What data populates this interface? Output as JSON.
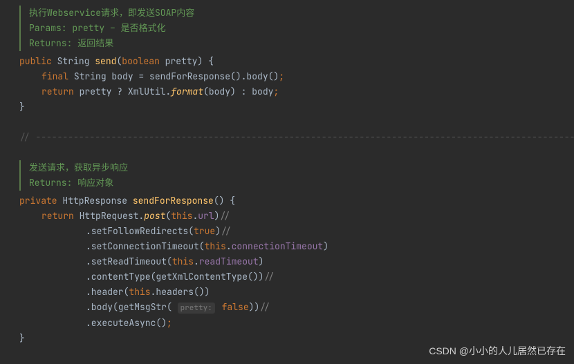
{
  "block1": {
    "doc1": "执行Webservice请求，即发送SOAP内容",
    "doc2_label": "Params:",
    "doc2_text": "  pretty – 是否格式化",
    "doc3_label": "Returns:",
    "doc3_text": " 返回结果",
    "sig": {
      "public": "public",
      "ret_type": "String",
      "name": "send",
      "paren_open": "(",
      "param_type": "boolean",
      "param_name": " pretty",
      "paren_close_brace": ") {"
    },
    "line1": {
      "final": "final",
      "decl": " String body = sendForResponse().body()",
      "semi": ";"
    },
    "line2": {
      "return": "return",
      "expr1": " pretty ? XmlUtil.",
      "format": "format",
      "expr2": "(body) : body",
      "semi": ";"
    },
    "close": "}"
  },
  "divider": "// ----------------------------------------------------------------------------------------------------------",
  "block2": {
    "doc1": "发送请求，获取异步响应",
    "doc2_label": "Returns:",
    "doc2_text": " 响应对象",
    "sig": {
      "private": "private",
      "ret_type": " HttpResponse ",
      "name": "sendForResponse",
      "tail": "() {"
    },
    "line1": {
      "return": "return",
      "pre": " HttpRequest.",
      "post": "post",
      "open": "(",
      "this": "this",
      "dot": ".",
      "url": "url",
      "close": ")",
      "cmt": "//"
    },
    "line2": {
      "txt": ".setFollowRedirects(",
      "true": "true",
      "close": ")",
      "cmt": "//"
    },
    "line3": {
      "txt": ".setConnectionTimeout(",
      "this": "this",
      "dot": ".",
      "fld": "connectionTimeout",
      "close": ")"
    },
    "line4": {
      "txt": ".setReadTimeout(",
      "this": "this",
      "dot": ".",
      "fld": "readTimeout",
      "close": ")"
    },
    "line5": {
      "txt": ".contentType(getXmlContentType())",
      "cmt": "//"
    },
    "line6": {
      "txt": ".header(",
      "this": "this",
      "dot": ".",
      "call": "headers())"
    },
    "line7": {
      "txt": ".body(getMsgStr( ",
      "hint": "pretty:",
      "false": "false",
      "close": "))",
      "cmt": "//"
    },
    "line8": {
      "txt": ".executeAsync()",
      "semi": ";"
    },
    "close": "}"
  },
  "watermark": "CSDN @小小的人儿居然已存在"
}
